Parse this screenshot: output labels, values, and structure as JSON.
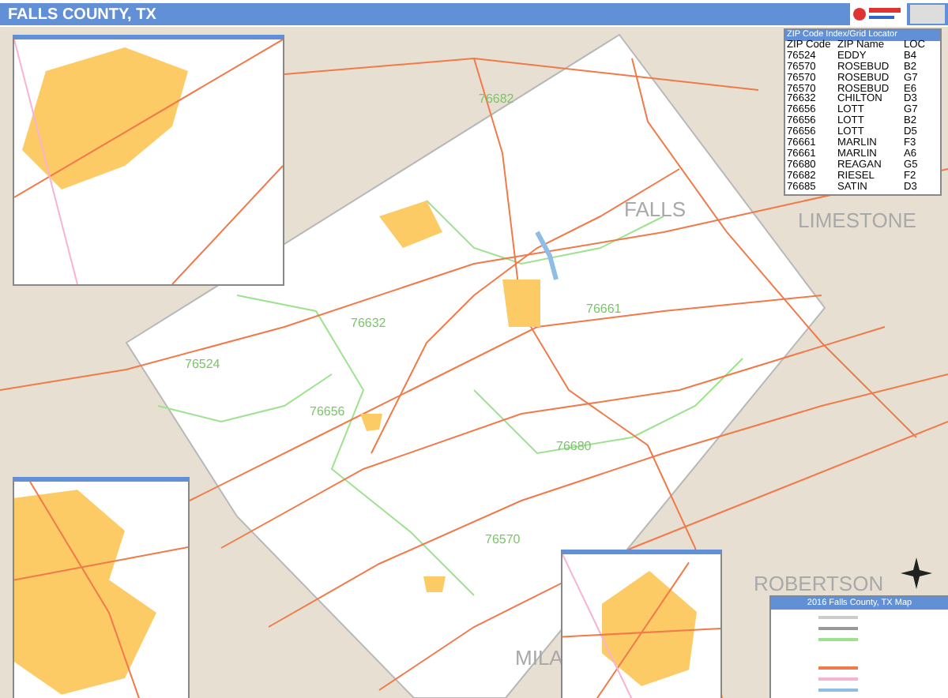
{
  "title": "FALLS COUNTY, TX",
  "zip_index": {
    "title": "ZIP Code Index/Grid Locator",
    "columns": [
      "ZIP Code",
      "ZIP Name",
      "LOC"
    ],
    "rows": [
      [
        "76524",
        "EDDY",
        "B4"
      ],
      [
        "76570",
        "ROSEBUD",
        "B2"
      ],
      [
        "76570",
        "ROSEBUD",
        "G7"
      ],
      [
        "76570",
        "ROSEBUD",
        "E6"
      ],
      [
        "76632",
        "CHILTON",
        "D3"
      ],
      [
        "76656",
        "LOTT",
        "G7"
      ],
      [
        "76656",
        "LOTT",
        "B2"
      ],
      [
        "76656",
        "LOTT",
        "D5"
      ],
      [
        "76661",
        "MARLIN",
        "F3"
      ],
      [
        "76661",
        "MARLIN",
        "A6"
      ],
      [
        "76680",
        "REAGAN",
        "G5"
      ],
      [
        "76682",
        "RIESEL",
        "F2"
      ],
      [
        "76685",
        "SATIN",
        "D3"
      ]
    ]
  },
  "county_labels": [
    "FALLS",
    "LIMESTONE",
    "ROBERTSON",
    "MILA"
  ],
  "zip_labels": [
    "76682",
    "76632",
    "76524",
    "76661",
    "76656",
    "76680",
    "76570"
  ],
  "legend": {
    "title": "2016 Falls County, TX Map"
  }
}
